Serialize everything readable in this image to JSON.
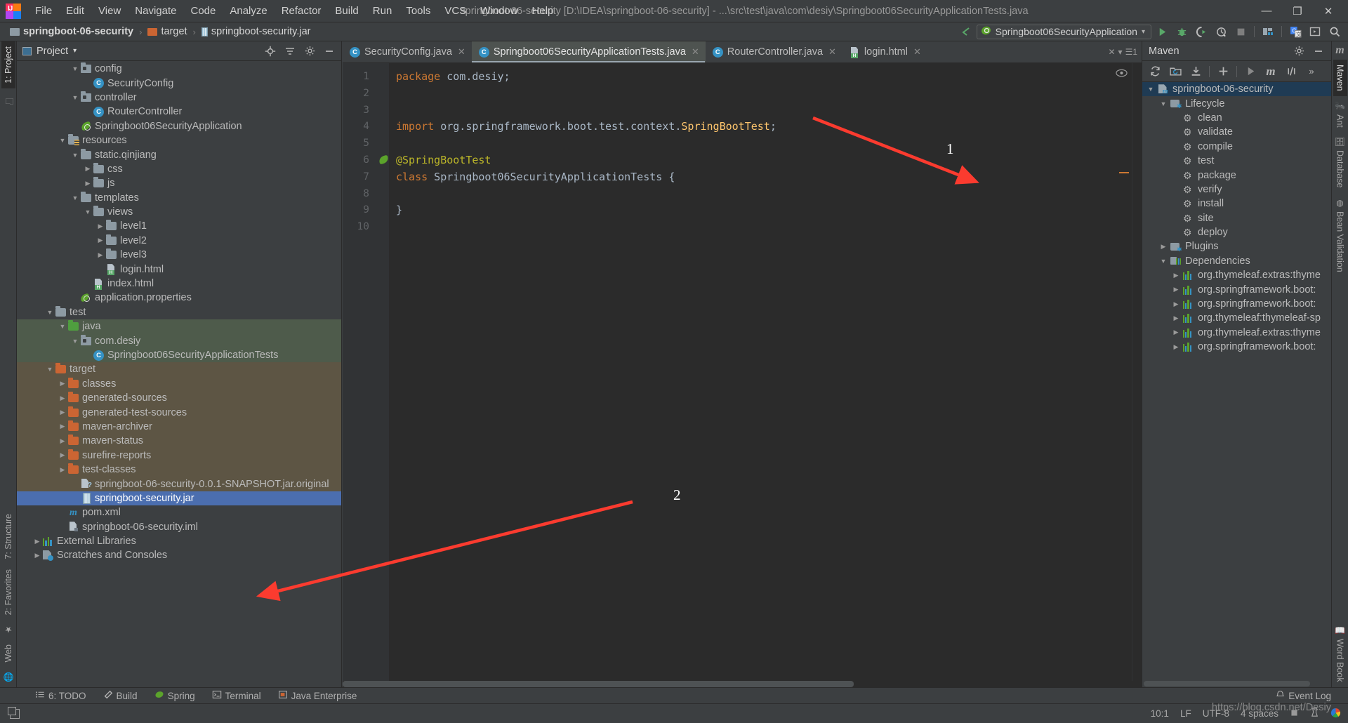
{
  "window": {
    "title": "springboot-06-security [D:\\IDEA\\springboot-06-security] - ...\\src\\test\\java\\com\\desiy\\Springboot06SecurityApplicationTests.java",
    "minimize": "—",
    "maximize": "❐",
    "close": "✕"
  },
  "menu": {
    "items": [
      "File",
      "Edit",
      "View",
      "Navigate",
      "Code",
      "Analyze",
      "Refactor",
      "Build",
      "Run",
      "Tools",
      "VCS",
      "Window",
      "Help"
    ]
  },
  "breadcrumb": {
    "items": [
      "springboot-06-security",
      "target",
      "springboot-security.jar"
    ],
    "separator": "›"
  },
  "run_toolbar": {
    "config_name": "Springboot06SecurityApplication",
    "dropdown_caret": "▾",
    "buttons": [
      "run",
      "debug",
      "run-with-coverage",
      "profile",
      "stop",
      "build-project",
      "search-everywhere-translate",
      "open-tool-window",
      "search"
    ]
  },
  "left_strip": {
    "tabs": [
      "1: Project",
      "7: Structure",
      "2: Favorites",
      "Web"
    ]
  },
  "right_strip": {
    "tabs": [
      "Maven",
      "Ant",
      "Database",
      "Bean Validation",
      "Word Book"
    ]
  },
  "project_panel": {
    "title": "Project",
    "caret": "▾",
    "actions": [
      "locate-icon",
      "collapse-all-icon",
      "settings-icon",
      "hide-icon"
    ],
    "tree": [
      {
        "label": "config",
        "indent": 4,
        "arrow": "▼",
        "icon": "package-folder",
        "state": "normal"
      },
      {
        "label": "SecurityConfig",
        "indent": 5,
        "arrow": "",
        "icon": "class",
        "state": "normal"
      },
      {
        "label": "controller",
        "indent": 4,
        "arrow": "▼",
        "icon": "package-folder",
        "state": "normal"
      },
      {
        "label": "RouterController",
        "indent": 5,
        "arrow": "",
        "icon": "class",
        "state": "normal"
      },
      {
        "label": "Springboot06SecurityApplication",
        "indent": 4,
        "arrow": "",
        "icon": "spring-boot",
        "state": "normal"
      },
      {
        "label": "resources",
        "indent": 3,
        "arrow": "▼",
        "icon": "resources-folder",
        "state": "normal"
      },
      {
        "label": "static.qinjiang",
        "indent": 4,
        "arrow": "▼",
        "icon": "folder-gray",
        "state": "normal"
      },
      {
        "label": "css",
        "indent": 5,
        "arrow": "▶",
        "icon": "folder-gray",
        "state": "normal"
      },
      {
        "label": "js",
        "indent": 5,
        "arrow": "▶",
        "icon": "folder-gray",
        "state": "normal"
      },
      {
        "label": "templates",
        "indent": 4,
        "arrow": "▼",
        "icon": "folder-gray",
        "state": "normal"
      },
      {
        "label": "views",
        "indent": 5,
        "arrow": "▼",
        "icon": "folder-gray",
        "state": "normal"
      },
      {
        "label": "level1",
        "indent": 6,
        "arrow": "▶",
        "icon": "folder-gray",
        "state": "normal"
      },
      {
        "label": "level2",
        "indent": 6,
        "arrow": "▶",
        "icon": "folder-gray",
        "state": "normal"
      },
      {
        "label": "level3",
        "indent": 6,
        "arrow": "▶",
        "icon": "folder-gray",
        "state": "normal"
      },
      {
        "label": "login.html",
        "indent": 6,
        "arrow": "",
        "icon": "html",
        "state": "normal"
      },
      {
        "label": "index.html",
        "indent": 5,
        "arrow": "",
        "icon": "html",
        "state": "normal"
      },
      {
        "label": "application.properties",
        "indent": 4,
        "arrow": "",
        "icon": "spring-properties",
        "state": "normal"
      },
      {
        "label": "test",
        "indent": 2,
        "arrow": "▼",
        "icon": "folder-gray",
        "state": "normal"
      },
      {
        "label": "java",
        "indent": 3,
        "arrow": "▼",
        "icon": "folder-green",
        "state": "test-source"
      },
      {
        "label": "com.desiy",
        "indent": 4,
        "arrow": "▼",
        "icon": "package-folder",
        "state": "test-source"
      },
      {
        "label": "Springboot06SecurityApplicationTests",
        "indent": 5,
        "arrow": "",
        "icon": "class",
        "state": "test-source"
      },
      {
        "label": "target",
        "indent": 2,
        "arrow": "▼",
        "icon": "folder-orange",
        "state": "target-dir"
      },
      {
        "label": "classes",
        "indent": 3,
        "arrow": "▶",
        "icon": "folder-orange",
        "state": "target-dir"
      },
      {
        "label": "generated-sources",
        "indent": 3,
        "arrow": "▶",
        "icon": "folder-orange",
        "state": "target-dir"
      },
      {
        "label": "generated-test-sources",
        "indent": 3,
        "arrow": "▶",
        "icon": "folder-orange",
        "state": "target-dir"
      },
      {
        "label": "maven-archiver",
        "indent": 3,
        "arrow": "▶",
        "icon": "folder-orange",
        "state": "target-dir"
      },
      {
        "label": "maven-status",
        "indent": 3,
        "arrow": "▶",
        "icon": "folder-orange",
        "state": "target-dir"
      },
      {
        "label": "surefire-reports",
        "indent": 3,
        "arrow": "▶",
        "icon": "folder-orange",
        "state": "target-dir"
      },
      {
        "label": "test-classes",
        "indent": 3,
        "arrow": "▶",
        "icon": "folder-orange",
        "state": "target-dir"
      },
      {
        "label": "springboot-06-security-0.0.1-SNAPSHOT.jar.original",
        "indent": 4,
        "arrow": "",
        "icon": "jar-unknown",
        "state": "target-dir"
      },
      {
        "label": "springboot-security.jar",
        "indent": 4,
        "arrow": "",
        "icon": "jar",
        "state": "selected"
      },
      {
        "label": "pom.xml",
        "indent": 3,
        "arrow": "",
        "icon": "maven",
        "state": "normal"
      },
      {
        "label": "springboot-06-security.iml",
        "indent": 3,
        "arrow": "",
        "icon": "iml",
        "state": "normal"
      },
      {
        "label": "External Libraries",
        "indent": 1,
        "arrow": "▶",
        "icon": "library",
        "state": "normal"
      },
      {
        "label": "Scratches and Consoles",
        "indent": 1,
        "arrow": "▶",
        "icon": "scratch",
        "state": "normal"
      }
    ]
  },
  "editor": {
    "tabs": [
      {
        "label": "SecurityConfig.java",
        "icon": "class",
        "active": false
      },
      {
        "label": "Springboot06SecurityApplicationTests.java",
        "icon": "class",
        "active": true
      },
      {
        "label": "RouterController.java",
        "icon": "class",
        "active": false
      },
      {
        "label": "login.html",
        "icon": "html",
        "active": false
      }
    ],
    "tab_close": "✕",
    "tab_overflow": "▾",
    "tab_overflow_count": "1",
    "line_numbers": [
      "1",
      "2",
      "3",
      "4",
      "5",
      "6",
      "7",
      "8",
      "9",
      "10"
    ],
    "code_lines": [
      {
        "n": 1,
        "tokens": [
          {
            "t": "package",
            "c": "kw"
          },
          {
            "t": " com.desiy;",
            "c": "plain"
          }
        ]
      },
      {
        "n": 2,
        "tokens": []
      },
      {
        "n": 3,
        "tokens": []
      },
      {
        "n": 4,
        "tokens": [
          {
            "t": "import",
            "c": "kw"
          },
          {
            "t": " org.springframework.boot.test.context.",
            "c": "plain"
          },
          {
            "t": "SpringBootTest",
            "c": "typ"
          },
          {
            "t": ";",
            "c": "plain"
          }
        ]
      },
      {
        "n": 5,
        "tokens": []
      },
      {
        "n": 6,
        "tokens": [
          {
            "t": "@SpringBootTest",
            "c": "ann"
          }
        ]
      },
      {
        "n": 7,
        "tokens": [
          {
            "t": "class",
            "c": "kw"
          },
          {
            "t": " Springboot06SecurityApplicationTests {",
            "c": "plain"
          }
        ]
      },
      {
        "n": 8,
        "tokens": []
      },
      {
        "n": 9,
        "tokens": [
          {
            "t": "}",
            "c": "plain"
          }
        ]
      },
      {
        "n": 10,
        "tokens": []
      }
    ],
    "gutter_marker_line": 6,
    "gutter_marker_icon": "spring-leaf-icon"
  },
  "maven_panel": {
    "title": "Maven",
    "header_actions": [
      "settings-icon",
      "hide-icon"
    ],
    "toolbar": [
      "reimport-icon",
      "generate-sources-icon",
      "download-sources-icon",
      "add-icon",
      "run-icon",
      "execute-goal-icon",
      "toggle-offline-icon",
      "more-icon"
    ],
    "tree": [
      {
        "label": "springboot-06-security",
        "indent": 0,
        "arrow": "▼",
        "icon": "maven-module",
        "selected": true
      },
      {
        "label": "Lifecycle",
        "indent": 1,
        "arrow": "▼",
        "icon": "folder-gear",
        "selected": false
      },
      {
        "label": "clean",
        "indent": 2,
        "arrow": "",
        "icon": "gear",
        "selected": false
      },
      {
        "label": "validate",
        "indent": 2,
        "arrow": "",
        "icon": "gear",
        "selected": false
      },
      {
        "label": "compile",
        "indent": 2,
        "arrow": "",
        "icon": "gear",
        "selected": false
      },
      {
        "label": "test",
        "indent": 2,
        "arrow": "",
        "icon": "gear",
        "selected": false
      },
      {
        "label": "package",
        "indent": 2,
        "arrow": "",
        "icon": "gear",
        "selected": false
      },
      {
        "label": "verify",
        "indent": 2,
        "arrow": "",
        "icon": "gear",
        "selected": false
      },
      {
        "label": "install",
        "indent": 2,
        "arrow": "",
        "icon": "gear",
        "selected": false
      },
      {
        "label": "site",
        "indent": 2,
        "arrow": "",
        "icon": "gear",
        "selected": false
      },
      {
        "label": "deploy",
        "indent": 2,
        "arrow": "",
        "icon": "gear",
        "selected": false
      },
      {
        "label": "Plugins",
        "indent": 1,
        "arrow": "▶",
        "icon": "folder-gear",
        "selected": false
      },
      {
        "label": "Dependencies",
        "indent": 1,
        "arrow": "▼",
        "icon": "folder-bars",
        "selected": false
      },
      {
        "label": "org.thymeleaf.extras:thyme",
        "indent": 2,
        "arrow": "▶",
        "icon": "library",
        "selected": false
      },
      {
        "label": "org.springframework.boot:",
        "indent": 2,
        "arrow": "▶",
        "icon": "library",
        "selected": false
      },
      {
        "label": "org.springframework.boot:",
        "indent": 2,
        "arrow": "▶",
        "icon": "library",
        "selected": false
      },
      {
        "label": "org.thymeleaf:thymeleaf-sp",
        "indent": 2,
        "arrow": "▶",
        "icon": "library",
        "selected": false
      },
      {
        "label": "org.thymeleaf.extras:thyme",
        "indent": 2,
        "arrow": "▶",
        "icon": "library",
        "selected": false
      },
      {
        "label": "org.springframework.boot:",
        "indent": 2,
        "arrow": "▶",
        "icon": "library",
        "selected": false
      }
    ]
  },
  "bottom_tabs": {
    "items": [
      {
        "label": "6: TODO",
        "icon": "todo-icon"
      },
      {
        "label": "Build",
        "icon": "build-hammer-icon"
      },
      {
        "label": "Spring",
        "icon": "spring-leaf-icon"
      },
      {
        "label": "Terminal",
        "icon": "terminal-icon"
      },
      {
        "label": "Java Enterprise",
        "icon": "java-enterprise-icon"
      }
    ],
    "event_log": "Event Log",
    "event_log_icon": "bell-icon"
  },
  "statusbar": {
    "caret_position": "10:1",
    "line_separator": "LF",
    "encoding": "UTF-8",
    "indent": "4 spaces",
    "lock_icon": "read-only-lock-icon",
    "inspection_icon": "inspection-icon",
    "theme_icon": "color-wheel-icon"
  },
  "annotations": {
    "items": [
      {
        "number": "1",
        "color": "#fb3b2f"
      },
      {
        "number": "2",
        "color": "#fb3b2f"
      }
    ]
  },
  "watermark": "https://blog.csdn.net/Desiy",
  "colors": {
    "accent_selection": "#4b6eaf",
    "test_source_bg": "#4e5b4b",
    "target_dir_bg": "#5d5544",
    "maven_selection": "#1f3b54",
    "annotation_red": "#fb3b2f",
    "editor_bg": "#2b2b2b",
    "panel_bg": "#3c3f41"
  }
}
